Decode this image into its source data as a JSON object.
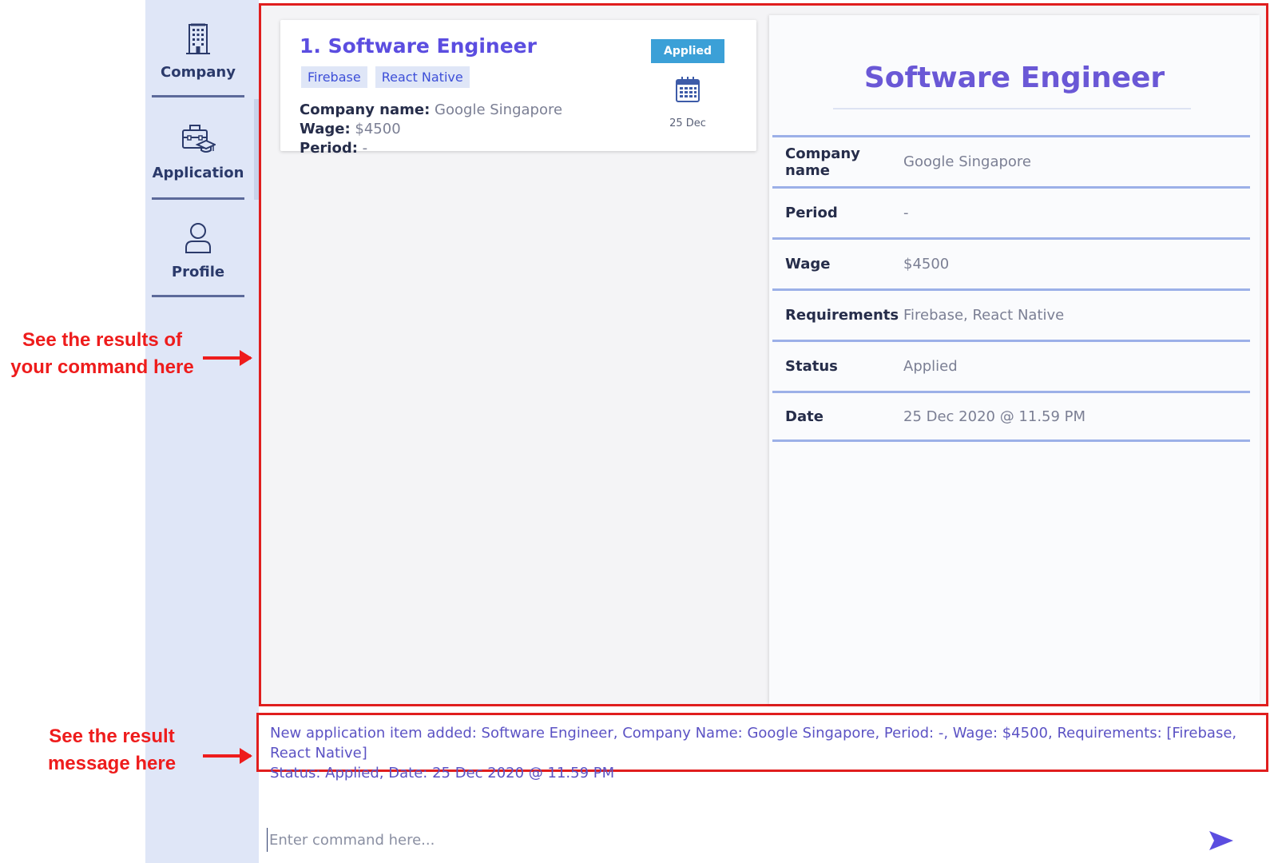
{
  "sidebar": {
    "items": [
      {
        "label": "Company",
        "icon": "building-icon"
      },
      {
        "label": "Application",
        "icon": "briefcase-graduation-icon"
      },
      {
        "label": "Profile",
        "icon": "person-icon"
      }
    ]
  },
  "annotations": {
    "results": "See the results of your command here",
    "message": "See the result message here"
  },
  "list": {
    "items": [
      {
        "title": "1.  Software Engineer",
        "tags": [
          "Firebase",
          "React Native"
        ],
        "company_key": "Company name:",
        "company_value": "Google Singapore",
        "wage_key": "Wage:",
        "wage_value": "$4500",
        "period_key": "Period:",
        "period_value": "-",
        "status": "Applied",
        "date": "25 Dec"
      }
    ]
  },
  "detail": {
    "title": "Software Engineer",
    "rows": [
      {
        "label": "Company name",
        "value": "Google Singapore"
      },
      {
        "label": "Period",
        "value": "-"
      },
      {
        "label": "Wage",
        "value": "$4500"
      },
      {
        "label": "Requirements",
        "value": "Firebase, React Native"
      },
      {
        "label": "Status",
        "value": "Applied"
      },
      {
        "label": "Date",
        "value": "25 Dec 2020 @ 11.59 PM"
      }
    ]
  },
  "result_message": {
    "line1": "New application item added: Software Engineer,  Company Name: Google Singapore,  Period: -,  Wage: $4500,  Requirements: [Firebase, React Native]",
    "line2": "Status: Applied,  Date: 25 Dec 2020 @ 11.59 PM"
  },
  "command": {
    "placeholder": "Enter command here...",
    "value": ""
  },
  "colors": {
    "accent": "#5b4de0",
    "sidebar_bg": "#dfe6f7",
    "status_badge": "#3ba0d7",
    "annotation_red": "#ee1c1c"
  }
}
